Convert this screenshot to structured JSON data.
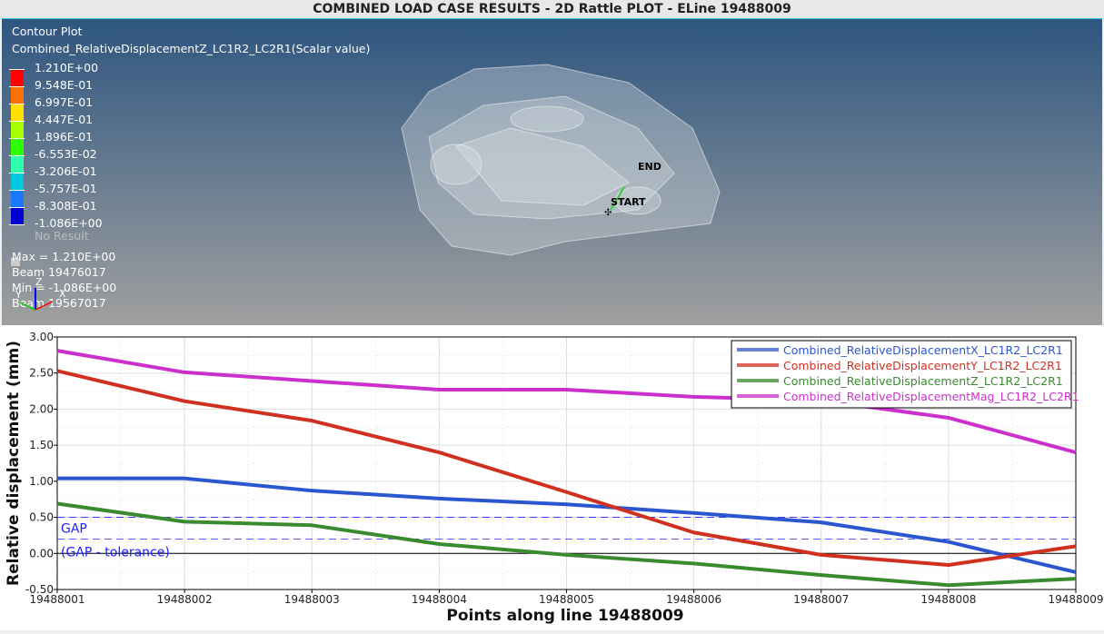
{
  "window_title": "COMBINED LOAD CASE RESULTS - 2D Rattle PLOT - ELine 19488009",
  "contour": {
    "title": "Contour Plot",
    "subtitle": "Combined_RelativeDisplacementZ_LC1R2_LC2R1(Scalar value)",
    "levels": [
      "1.210E+00",
      "9.548E-01",
      "6.997E-01",
      "4.447E-01",
      "1.896E-01",
      "-6.553E-02",
      "-3.206E-01",
      "-5.757E-01",
      "-8.308E-01",
      "-1.086E+00"
    ],
    "colors": [
      "#ff0000",
      "#ff7000",
      "#ffe000",
      "#a8ff00",
      "#30ff00",
      "#30ffb0",
      "#00c8e0",
      "#1878ff",
      "#0000d0"
    ],
    "no_result": "No Result",
    "max": "Max =  1.210E+00",
    "max_beam": "Beam 19476017",
    "min": "Min = -1.086E+00",
    "min_beam": "Beam 19567017",
    "axis_x": "X",
    "axis_y": "Y",
    "axis_z": "Z",
    "label_end": "END",
    "label_start": "START"
  },
  "chart_data": {
    "type": "line",
    "xlabel": "Points along line 19488009",
    "ylabel": "Relative displacement (mm)",
    "categories": [
      "19488001",
      "19488002",
      "19488003",
      "19488004",
      "19488005",
      "19488006",
      "19488007",
      "19488008",
      "19488009"
    ],
    "ylim": [
      -0.5,
      3.0
    ],
    "yticks": [
      "3.00",
      "2.50",
      "2.00",
      "1.50",
      "1.00",
      "0.50",
      "0.00",
      "-0.50"
    ],
    "grid": true,
    "legend_position": "top-right",
    "series": [
      {
        "name": "Combined_RelativeDisplacementX_LC1R2_LC2R1",
        "color": "#2a56d0",
        "values": [
          1.04,
          1.04,
          0.87,
          0.76,
          0.68,
          0.56,
          0.43,
          0.16,
          -0.26
        ]
      },
      {
        "name": "Combined_RelativeDisplacementY_LC1R2_LC2R1",
        "color": "#d03020",
        "values": [
          2.53,
          2.11,
          1.84,
          1.4,
          0.85,
          0.29,
          -0.02,
          -0.16,
          0.1
        ]
      },
      {
        "name": "Combined_RelativeDisplacementZ_LC1R2_LC2R1",
        "color": "#3a8a30",
        "values": [
          0.69,
          0.44,
          0.39,
          0.13,
          -0.02,
          -0.14,
          -0.3,
          -0.44,
          -0.35
        ]
      },
      {
        "name": "Combined_RelativeDisplacementMag_LC1R2_LC2R1",
        "color": "#cc30cc",
        "values": [
          2.81,
          2.51,
          2.39,
          2.27,
          2.27,
          2.17,
          2.12,
          1.88,
          1.4
        ]
      }
    ],
    "reference_lines": [
      {
        "label": "GAP",
        "value": 0.5,
        "color": "#2020ff"
      },
      {
        "label": "(GAP - tolerance)",
        "value": 0.2,
        "color": "#2020ff"
      }
    ]
  }
}
